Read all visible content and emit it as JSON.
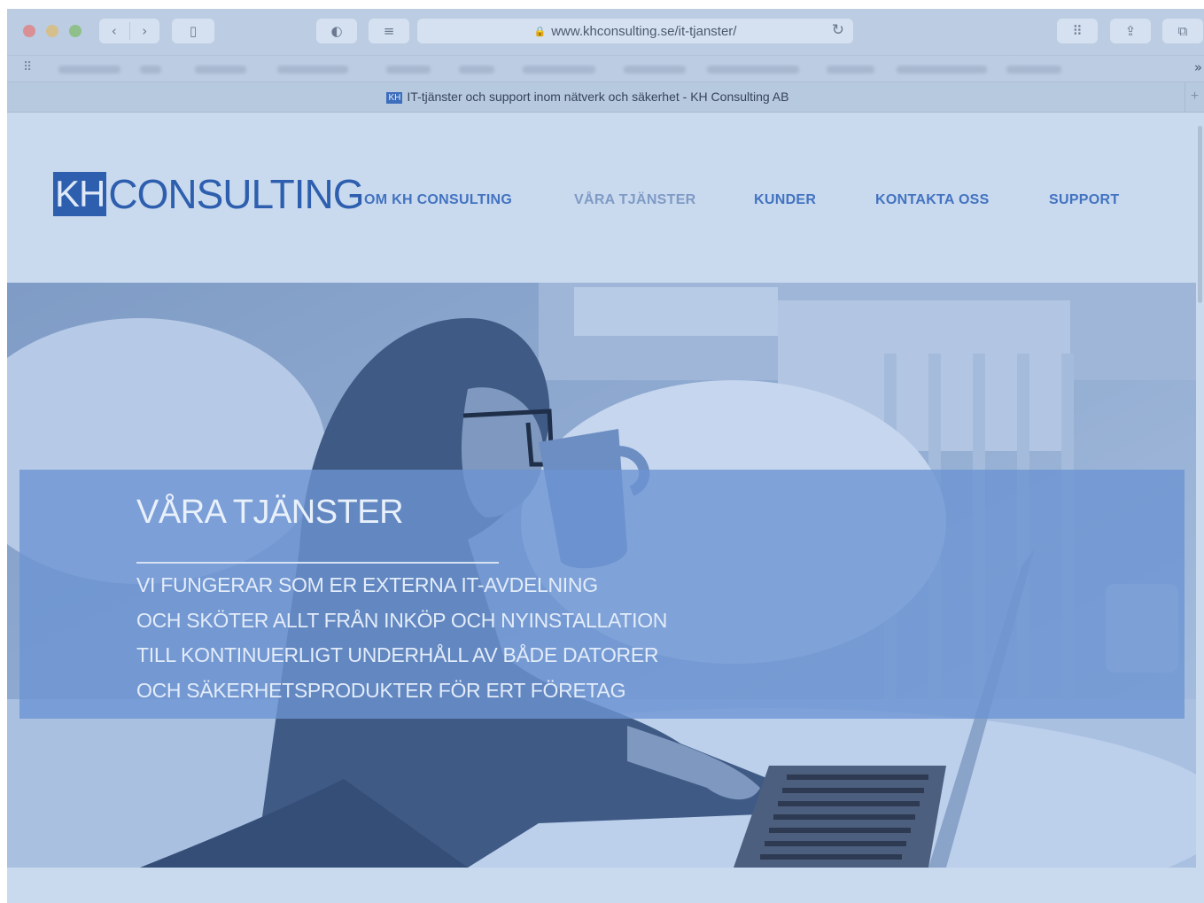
{
  "browser": {
    "url": "www.khconsulting.se/it-tjanster/",
    "tab_title": "IT-tjänster och support inom nätverk och säkerhet - KH Consulting AB",
    "favicon_text": "KH",
    "icons": {
      "back": "‹",
      "forward": "›",
      "sidebar": "▯",
      "shield": "◐",
      "reader": "≡",
      "lock": "🔒",
      "reload": "↻",
      "grid": "⠿",
      "share": "⇪",
      "tabs": "⧉",
      "bookmarks_grid": "⠿",
      "more": "»",
      "new_tab": "+"
    }
  },
  "site": {
    "logo": {
      "box_text": "KH",
      "text": "CONSULTING"
    },
    "nav": [
      {
        "label": "OM KH CONSULTING"
      },
      {
        "label": "VÅRA TJÄNSTER"
      },
      {
        "label": "KUNDER"
      },
      {
        "label": "KONTAKTA OSS"
      },
      {
        "label": "SUPPORT"
      }
    ],
    "hero": {
      "title": "VÅRA TJÄNSTER",
      "lines": [
        "VI FUNGERAR SOM ER EXTERNA IT-AVDELNING",
        "OCH SKÖTER ALLT FRÅN INKÖP OCH NYINSTALLATION",
        "TILL KONTINUERLIGT UNDERHÅLL AV BÅDE DATORER",
        "OCH SÄKERHETSPRODUKTER FÖR ERT FÖRETAG"
      ]
    }
  },
  "colors": {
    "brand": "#2e5fae",
    "nav": "#4373c0",
    "nav_active": "#7f9ac4",
    "overlay": "#6c94d2"
  }
}
